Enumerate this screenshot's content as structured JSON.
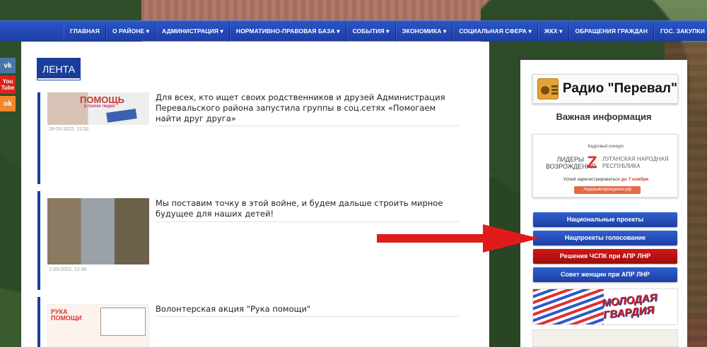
{
  "nav": {
    "items": [
      "ГЛАВНАЯ",
      "О РАЙОНЕ ▾",
      "АДМИНИСТРАЦИЯ ▾",
      "НОРМАТИВНО-ПРАВОВАЯ БАЗА ▾",
      "СОБЫТИЯ ▾",
      "ЭКОНОМИКА ▾",
      "СОЦИАЛЬНАЯ СФЕРА ▾",
      "ЖКХ ▾",
      "ОБРАЩЕНИЯ ГРАЖДАН",
      "ГОС. ЗАКУПКИ"
    ]
  },
  "social": {
    "vk": "vk",
    "youtube_1": "You",
    "youtube_2": "Tube",
    "ok": "ok"
  },
  "feed": {
    "title": "ЛЕНТА",
    "items": [
      {
        "title": "Для всех, кто ищет своих родственников и друзей Администрация Перевальского района запустила группы в соц.сетях «Помогаем найти друг друга»",
        "date": "26-03-2022, 11:52",
        "thumb_text": "ПОМОЩЬ",
        "thumb_sub": "в поиске людей"
      },
      {
        "title": "Мы поставим точку в этой войне, и будем дальше строить мирное будущее для наших детей!",
        "date": "2-03-2022, 12:34"
      },
      {
        "title": "Волонтерская акция \"Рука помощи\"",
        "thumb_text": "РУКА ПОМОЩИ"
      }
    ]
  },
  "sidebar": {
    "radio": "Радио \"Перевал\"",
    "important": "Важная информация",
    "leaders": {
      "top": "Кадровый конкурс",
      "main": "ЛИДЕРЫ ВОЗРОЖДЕНИЯ",
      "z": "Z",
      "region": "ЛУГАНСКАЯ НАРОДНАЯ РЕСПУБЛИКА",
      "date_prefix": "Успей зарегистрироваться ",
      "date_highlight": "до 7 ноября",
      "site": "лидерывозрождения.рф"
    },
    "buttons": [
      "Национальные проекты",
      "Нацпроекты голосование",
      "Решения ЧСПК при АПР ЛНР",
      "Совет женщин при АПР ЛНР"
    ],
    "guard": "МОЛОДАЯ ГВАРДИЯ"
  },
  "colors": {
    "nav_bg": "#1e3fa8",
    "accent_blue": "#1a3d9c",
    "accent_red": "#d41818",
    "arrow_red": "#e11b1b"
  }
}
